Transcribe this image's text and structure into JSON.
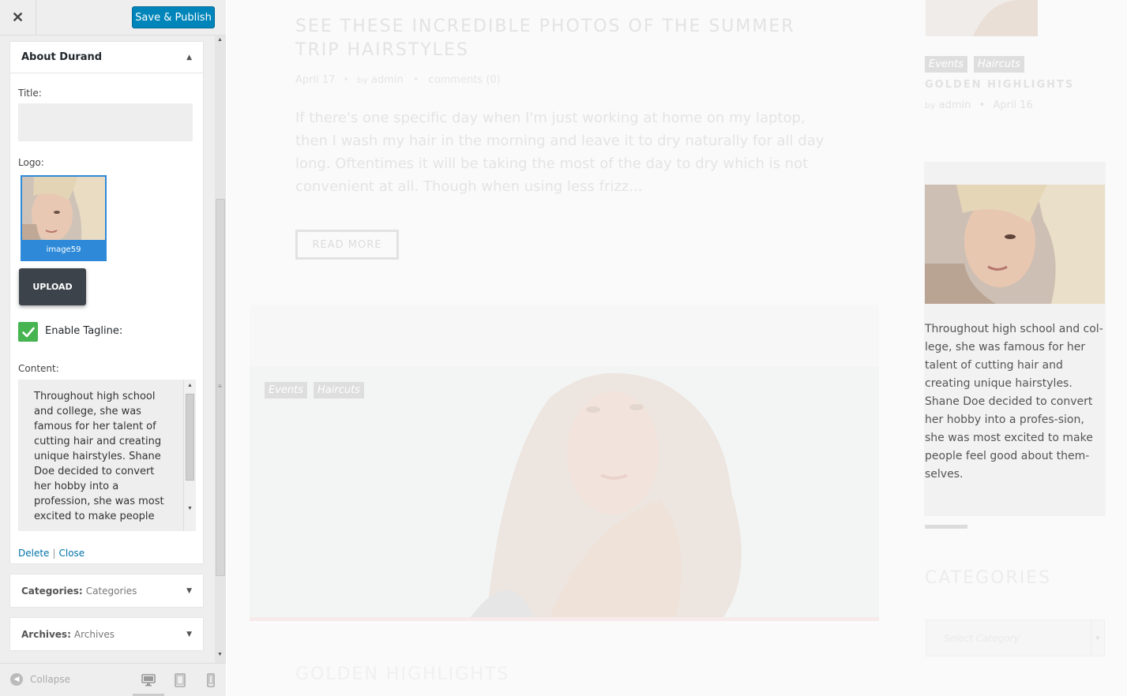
{
  "header": {
    "close_label": "✕",
    "publish_label": "Save & Publish"
  },
  "widget_about": {
    "title": "About Durand",
    "title_label": "Title:",
    "title_value": "",
    "logo_label": "Logo:",
    "logo_filename": "image59",
    "upload_label": "UPLOAD",
    "tagline_label": "Enable Tagline:",
    "tagline_checked": true,
    "content_label": "Content:",
    "content_value": "Throughout high school and college, she was famous for her talent of cutting hair and creating unique hairstyles. Shane Doe decided to convert her hobby into a profession, she was most excited to make people",
    "delete_label": "Delete",
    "separator": "|",
    "close_label": "Close"
  },
  "widget_categories": {
    "name": "Categories:",
    "value": "Categories"
  },
  "widget_archives": {
    "name": "Archives:",
    "value": "Archives"
  },
  "footer": {
    "collapse_label": "Collapse",
    "icons": [
      "desktop-icon",
      "tablet-icon",
      "mobile-icon"
    ]
  },
  "preview": {
    "post_title": "SEE THESE INCREDIBLE PHOTOS OF THE SUMMER TRIP HAIRSTYLES",
    "post_date": "April 17",
    "post_by": "by",
    "post_author": "admin",
    "post_comments": "comments (0)",
    "post_excerpt": "If there's one specific day when I'm just working at home on my laptop, then I wash my hair in the morning and leave it to dry naturally for all day long. Oftentimes it will be taking the most of the day to dry which is not convenient at all. Though when using less frizz...",
    "read_more": "READ MORE",
    "tag_events": "Events",
    "tag_haircuts": "Haircuts",
    "next_title": "GOLDEN HIGHLIGHTS"
  },
  "right_column": {
    "tag_events": "Events",
    "tag_haircuts": "Haircuts",
    "title": "GOLDEN HIGHLIGHTS",
    "by": "by",
    "author": "admin",
    "date": "April 16",
    "about_text": "Throughout high school and col-lege, she was famous for her talent of cutting hair and creating unique hairstyles. Shane Doe decided to convert her hobby into a profes-sion, she was most excited to make people feel good about them-selves.",
    "categories_title": "CATEGORIES",
    "select_placeholder": "Select Category"
  },
  "colors": {
    "publish": "#0085ba",
    "upload": "#3c434a",
    "checkbox": "#46b450",
    "link": "#0073aa",
    "logo_selected": "#2e8ad8"
  }
}
